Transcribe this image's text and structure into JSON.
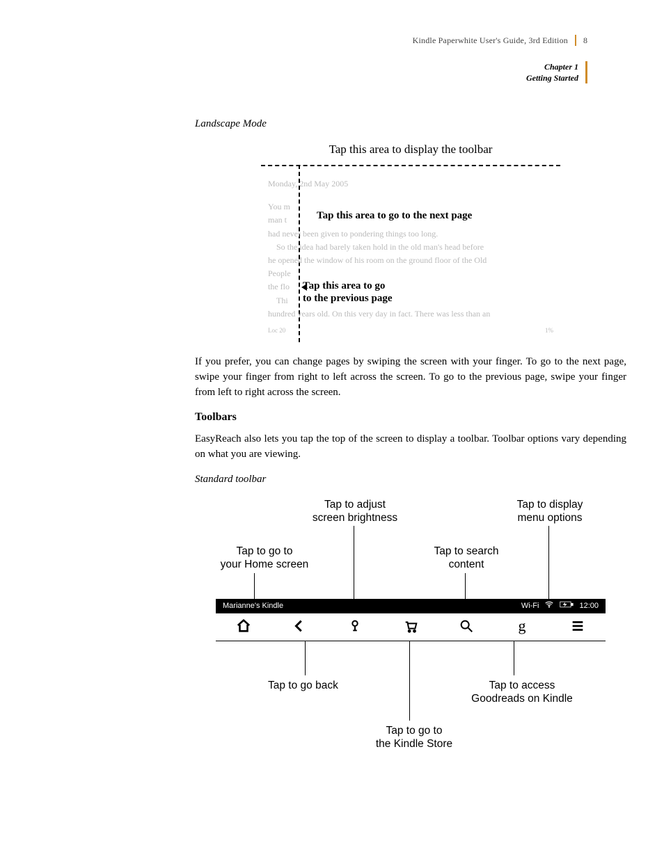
{
  "header": {
    "doc_title": "Kindle Paperwhite User's Guide, 3rd Edition",
    "page_number": "8",
    "chapter_num": "Chapter 1",
    "chapter_title": "Getting Started"
  },
  "landscape": {
    "label": "Landscape Mode",
    "caption_top": "Tap this area to display the toolbar",
    "annot_next": "Tap this area to go to the next page",
    "annot_prev_l1": "Tap this area to go",
    "annot_prev_l2": "to the previous page",
    "sample_date": "Monday, 2nd May 2005",
    "sample_line1_a": "You m",
    "sample_line1_b": "man t",
    "sample_line2": "had never been given to pondering things too long.",
    "sample_line3": "So the idea had barely taken hold in the old man's head before",
    "sample_line4": "he opened the window of his room on the ground floor of the Old",
    "sample_line5": "People",
    "sample_line6": "the flo",
    "sample_line7": "Thi",
    "sample_line8": "hundred years old. On this very day in fact. There was less than an",
    "footer_left": "Loc 20",
    "footer_right": "1%"
  },
  "paragraphs": {
    "swipe": "If you prefer, you can change pages by swiping the screen with your finger. To go to the next page, swipe your finger from right to left across the screen. To go to the previous page, swipe your finger from left to right across the screen.",
    "toolbars_h": "Toolbars",
    "toolbars_p": "EasyReach also lets you tap the top of the screen to display a toolbar. Toolbar options vary depending on what you are viewing.",
    "std_label": "Standard toolbar"
  },
  "toolbar": {
    "labels": {
      "brightness_l1": "Tap to adjust",
      "brightness_l2": "screen brightness",
      "menu_l1": "Tap to display",
      "menu_l2": "menu options",
      "home_l1": "Tap to go to",
      "home_l2": "your Home screen",
      "search_l1": "Tap to search",
      "search_l2": "content",
      "back": "Tap to go back",
      "goodreads_l1": "Tap to access",
      "goodreads_l2": "Goodreads on Kindle",
      "store_l1": "Tap to go to",
      "store_l2": "the Kindle Store"
    },
    "statusbar": {
      "device_name": "Marianne's Kindle",
      "wifi_label": "Wi-Fi",
      "time": "12:00"
    }
  }
}
